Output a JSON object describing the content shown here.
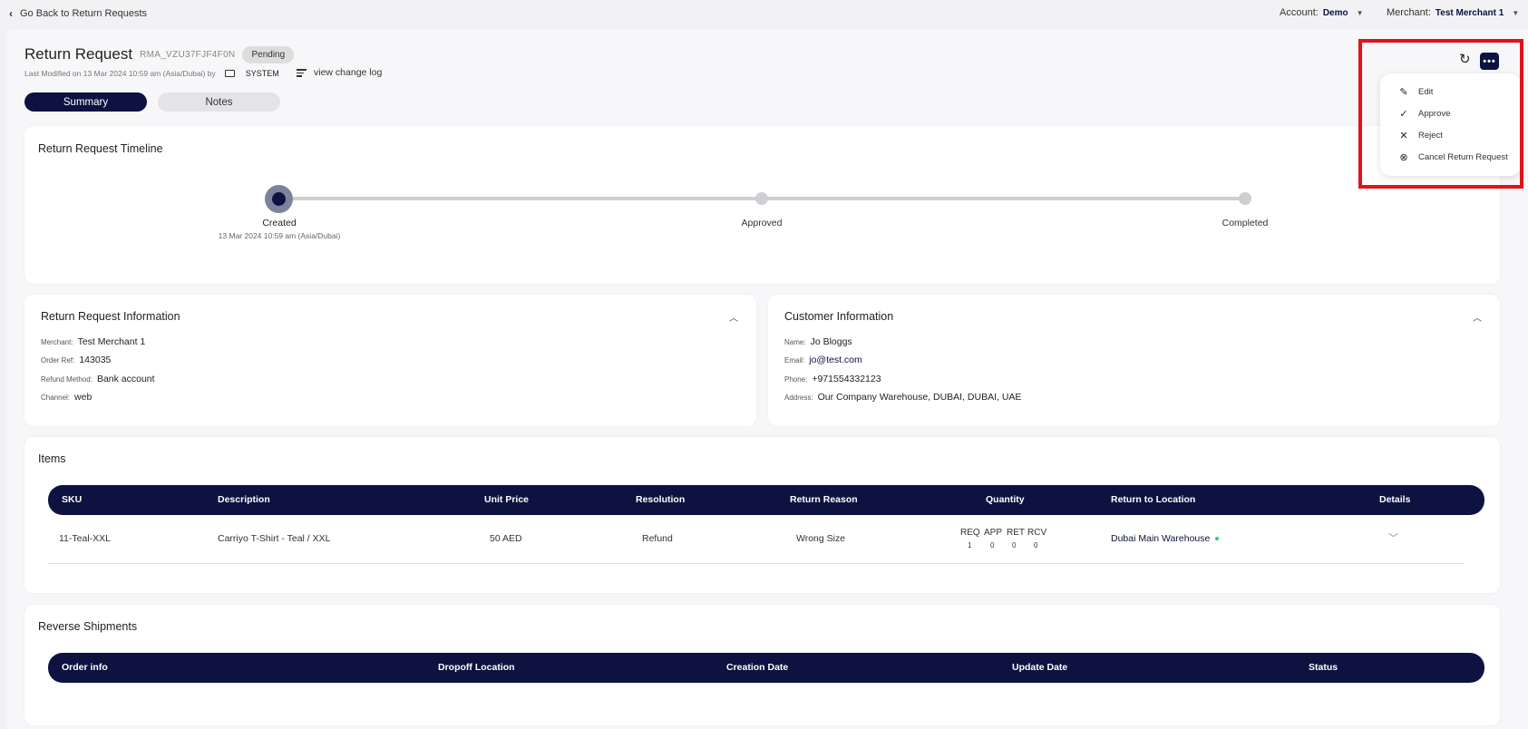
{
  "topbar": {
    "back_label": "Go Back to Return Requests",
    "account_label": "Account:",
    "account_value": "Demo",
    "merchant_label": "Merchant:",
    "merchant_value": "Test Merchant 1"
  },
  "header": {
    "title": "Return Request",
    "rma": "RMA_VZU37FJF4F0N",
    "status": "Pending",
    "modified": "Last Modified on 13 Mar 2024 10:59 am (Asia/Dubai) by",
    "modified_by": "SYSTEM",
    "change_log": "view change log"
  },
  "tabs": {
    "summary": "Summary",
    "notes": "Notes"
  },
  "timeline": {
    "title": "Return Request Timeline",
    "steps": [
      {
        "label": "Created",
        "sub": "13 Mar 2024 10:59 am (Asia/Dubai)"
      },
      {
        "label": "Approved"
      },
      {
        "label": "Completed"
      }
    ]
  },
  "return_info": {
    "title": "Return Request Information",
    "rows": [
      {
        "k": "Merchant:",
        "v": "Test Merchant 1"
      },
      {
        "k": "Order Ref:",
        "v": "143035"
      },
      {
        "k": "Refund Method:",
        "v": "Bank account"
      },
      {
        "k": "Channel:",
        "v": "web"
      }
    ]
  },
  "customer_info": {
    "title": "Customer Information",
    "rows": [
      {
        "k": "Name:",
        "v": "Jo Bloggs"
      },
      {
        "k": "Email:",
        "v": "jo@test.com"
      },
      {
        "k": "Phone:",
        "v": "+971554332123"
      },
      {
        "k": "Address:",
        "v": "Our Company Warehouse, DUBAI, DUBAI, UAE"
      }
    ]
  },
  "items": {
    "title": "Items",
    "headers": [
      "SKU",
      "Description",
      "Unit Price",
      "Resolution",
      "Return Reason",
      "Quantity",
      "Return to Location",
      "Details"
    ],
    "row": {
      "sku": "11-Teal-XXL",
      "description": "Carriyo T-Shirt - Teal / XXL",
      "unit_price": "50 AED",
      "resolution": "Refund",
      "reason": "Wrong Size",
      "qty_labels": [
        "REQ",
        "APP",
        "RET",
        "RCV"
      ],
      "qty_values": [
        "1",
        "0",
        "0",
        "0"
      ],
      "location": "Dubai Main Warehouse"
    }
  },
  "shipments": {
    "title": "Reverse Shipments",
    "headers": [
      "Order info",
      "Dropoff Location",
      "Creation Date",
      "Update Date",
      "Status"
    ]
  },
  "menu": {
    "items": [
      {
        "label": "Edit",
        "icon": "pencil-icon"
      },
      {
        "label": "Approve",
        "icon": "check-icon"
      },
      {
        "label": "Reject",
        "icon": "x-icon"
      },
      {
        "label": "Cancel Return Request",
        "icon": "cancel-circle-icon"
      }
    ]
  },
  "colors": {
    "navy": "#0d1240",
    "highlight": "#e0131a",
    "location_dot": "#2ecc71"
  }
}
